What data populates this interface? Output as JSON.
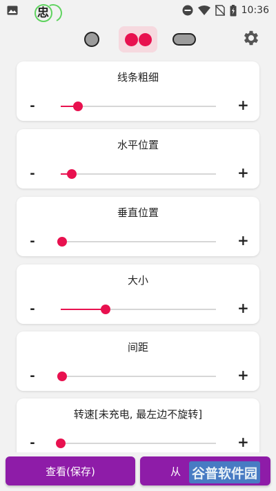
{
  "status_bar": {
    "time": "10:36",
    "app_glyph": "忠",
    "icons": [
      "image-icon",
      "app-indicator-icon",
      "do-not-disturb-icon",
      "wifi-icon",
      "no-sim-icon",
      "battery-icon"
    ]
  },
  "top_bar": {
    "shapes": [
      "circle",
      "double-dot",
      "pill"
    ],
    "selected_shape": "double-dot",
    "settings_icon": "gear-icon"
  },
  "sliders": [
    {
      "label": "线条粗细",
      "minus": "-",
      "plus": "+",
      "value": 0.11
    },
    {
      "label": "水平位置",
      "minus": "-",
      "plus": "+",
      "value": 0.07
    },
    {
      "label": "垂直位置",
      "minus": "-",
      "plus": "+",
      "value": 0.01
    },
    {
      "label": "大小",
      "minus": "-",
      "plus": "+",
      "value": 0.29
    },
    {
      "label": "间距",
      "minus": "-",
      "plus": "+",
      "value": 0.01
    },
    {
      "label": "转速[未充电, 最左边不旋转]",
      "minus": "-",
      "plus": "+",
      "value": 0.0
    }
  ],
  "buttons": {
    "view_save": "查看(保存)",
    "from_partial": "从"
  },
  "watermark": "谷普软件园",
  "colors": {
    "accent": "#e8114f",
    "button": "#8e1ca8",
    "selected_bg": "#f6d9df"
  }
}
